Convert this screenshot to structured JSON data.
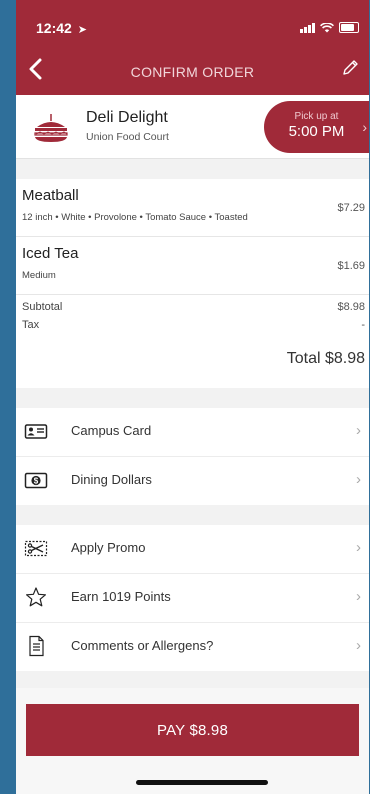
{
  "status_bar": {
    "time": "12:42",
    "location_arrow": "➤"
  },
  "nav": {
    "title": "CONFIRM ORDER"
  },
  "vendor": {
    "name": "Deli Delight",
    "location": "Union Food Court",
    "pickup_label": "Pick up at",
    "pickup_time": "5:00 PM"
  },
  "items": [
    {
      "name": "Meatball",
      "desc": "12 inch • White • Provolone • Tomato Sauce • Toasted",
      "price": "$7.29"
    },
    {
      "name": "Iced Tea",
      "desc": "Medium",
      "price": "$1.69"
    }
  ],
  "summary": {
    "subtotal_label": "Subtotal",
    "subtotal_value": "$8.98",
    "tax_label": "Tax",
    "tax_value": "-",
    "total": "Total $8.98"
  },
  "payment_methods": [
    {
      "label": "Campus Card",
      "icon": "id-card-icon"
    },
    {
      "label": "Dining Dollars",
      "icon": "dollar-icon"
    }
  ],
  "extras": [
    {
      "label": "Apply Promo",
      "icon": "scissors-icon"
    },
    {
      "label": "Earn 1019 Points",
      "icon": "star-icon"
    },
    {
      "label": "Comments or Allergens?",
      "icon": "document-icon"
    }
  ],
  "chevron": "›",
  "pay_button": "PAY $8.98",
  "colors": {
    "brand": "#a02a39",
    "background": "#f2f2f2"
  }
}
